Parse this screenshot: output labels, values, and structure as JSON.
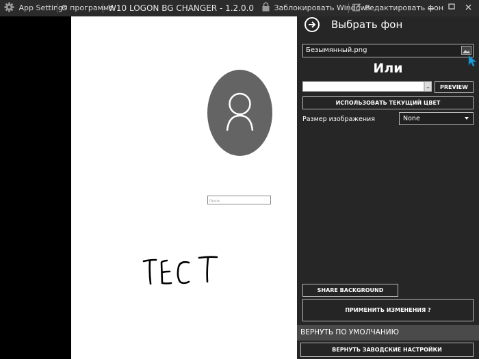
{
  "titlebar": {
    "app_settings": "App Settings",
    "about": "О программе",
    "app_title": "W10 LOGON BG CHANGER - 1.2.0.0",
    "lock_windows": "Заблокировать Windows",
    "edit_background": "Редактировать фон",
    "icons": {
      "settings": "gear-icon",
      "lock": "lock-icon",
      "edit": "edit-icon"
    }
  },
  "preview": {
    "password_placeholder": "Пароль",
    "handwritten_text": "ТЕСТ",
    "colors": {
      "side": "#000000",
      "screen": "#ffffff",
      "avatar": "#646464"
    }
  },
  "panel": {
    "title": "Выбрать фон",
    "file_name": "Безымянный.png",
    "or_label": "Или",
    "color_value": "",
    "preview_button": "PREVIEW",
    "use_current_color_button": "ИСПОЛЬЗОВАТЬ ТЕКУЩИЙ ЦВЕТ",
    "image_size_label": "Размер изображения",
    "image_size_value": "None",
    "share_button": "SHARE BACKGROUND",
    "apply_button": "ПРИМЕНИТЬ ИЗМЕНЕНИЯ ?",
    "reset_section_label": "ВЕРНУТЬ ПО УМОЛЧАНИЮ",
    "factory_reset_button": "ВЕРНУТЬ ЗАВОДСКИЕ НАСТРОЙКИ",
    "colors": {
      "background": "#262626",
      "reset_bar": "#4a4a4a",
      "cursor": "#1e9bd7"
    }
  }
}
